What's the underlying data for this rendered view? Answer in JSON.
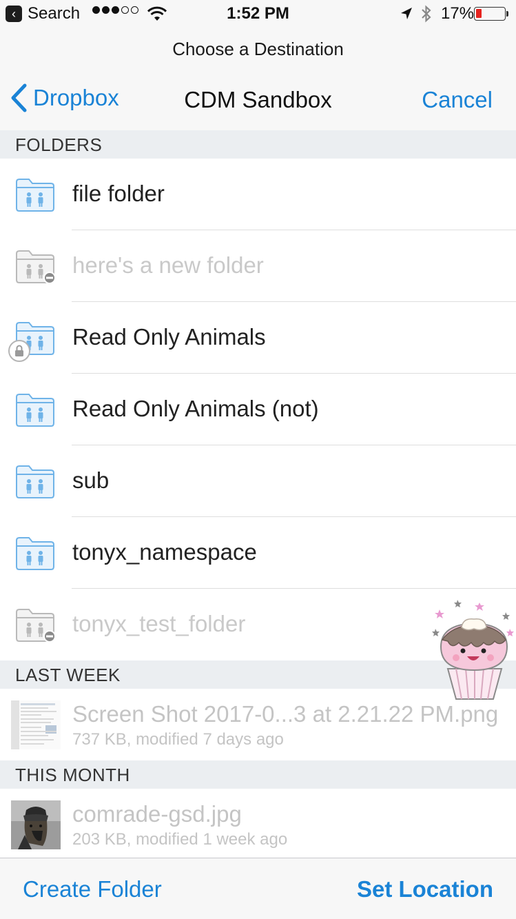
{
  "status_bar": {
    "back_app": "Search",
    "signal_filled": 3,
    "signal_total": 5,
    "time": "1:52 PM",
    "battery_percent": "17%",
    "battery_color": "#e6231f"
  },
  "header": {
    "prompt": "Choose a Destination",
    "back_label": "Dropbox",
    "title": "CDM Sandbox",
    "cancel_label": "Cancel"
  },
  "sections": {
    "folders": "FOLDERS",
    "last_week": "LAST WEEK",
    "this_month": "THIS MONTH"
  },
  "folders": [
    {
      "name": "file folder",
      "disabled": false,
      "badge": ""
    },
    {
      "name": "here's a new folder",
      "disabled": true,
      "badge": "minus"
    },
    {
      "name": "Read Only Animals",
      "disabled": false,
      "badge": "lock"
    },
    {
      "name": "Read Only Animals (not)",
      "disabled": false,
      "badge": ""
    },
    {
      "name": "sub",
      "disabled": false,
      "badge": ""
    },
    {
      "name": "tonyx_namespace",
      "disabled": false,
      "badge": ""
    },
    {
      "name": "tonyx_test_folder",
      "disabled": true,
      "badge": "minus"
    }
  ],
  "files": [
    {
      "name": "Screen Shot 2017-0...3 at 2.21.22 PM.png",
      "meta": "737 KB, modified 7 days ago"
    },
    {
      "name": "comrade-gsd.jpg",
      "meta": "203 KB, modified 1 week ago"
    }
  ],
  "toolbar": {
    "create_label": "Create Folder",
    "set_label": "Set Location"
  },
  "colors": {
    "accent": "#1a83d6",
    "folder_blue": "#6fb3e8",
    "folder_disabled": "#b9b9b9"
  }
}
